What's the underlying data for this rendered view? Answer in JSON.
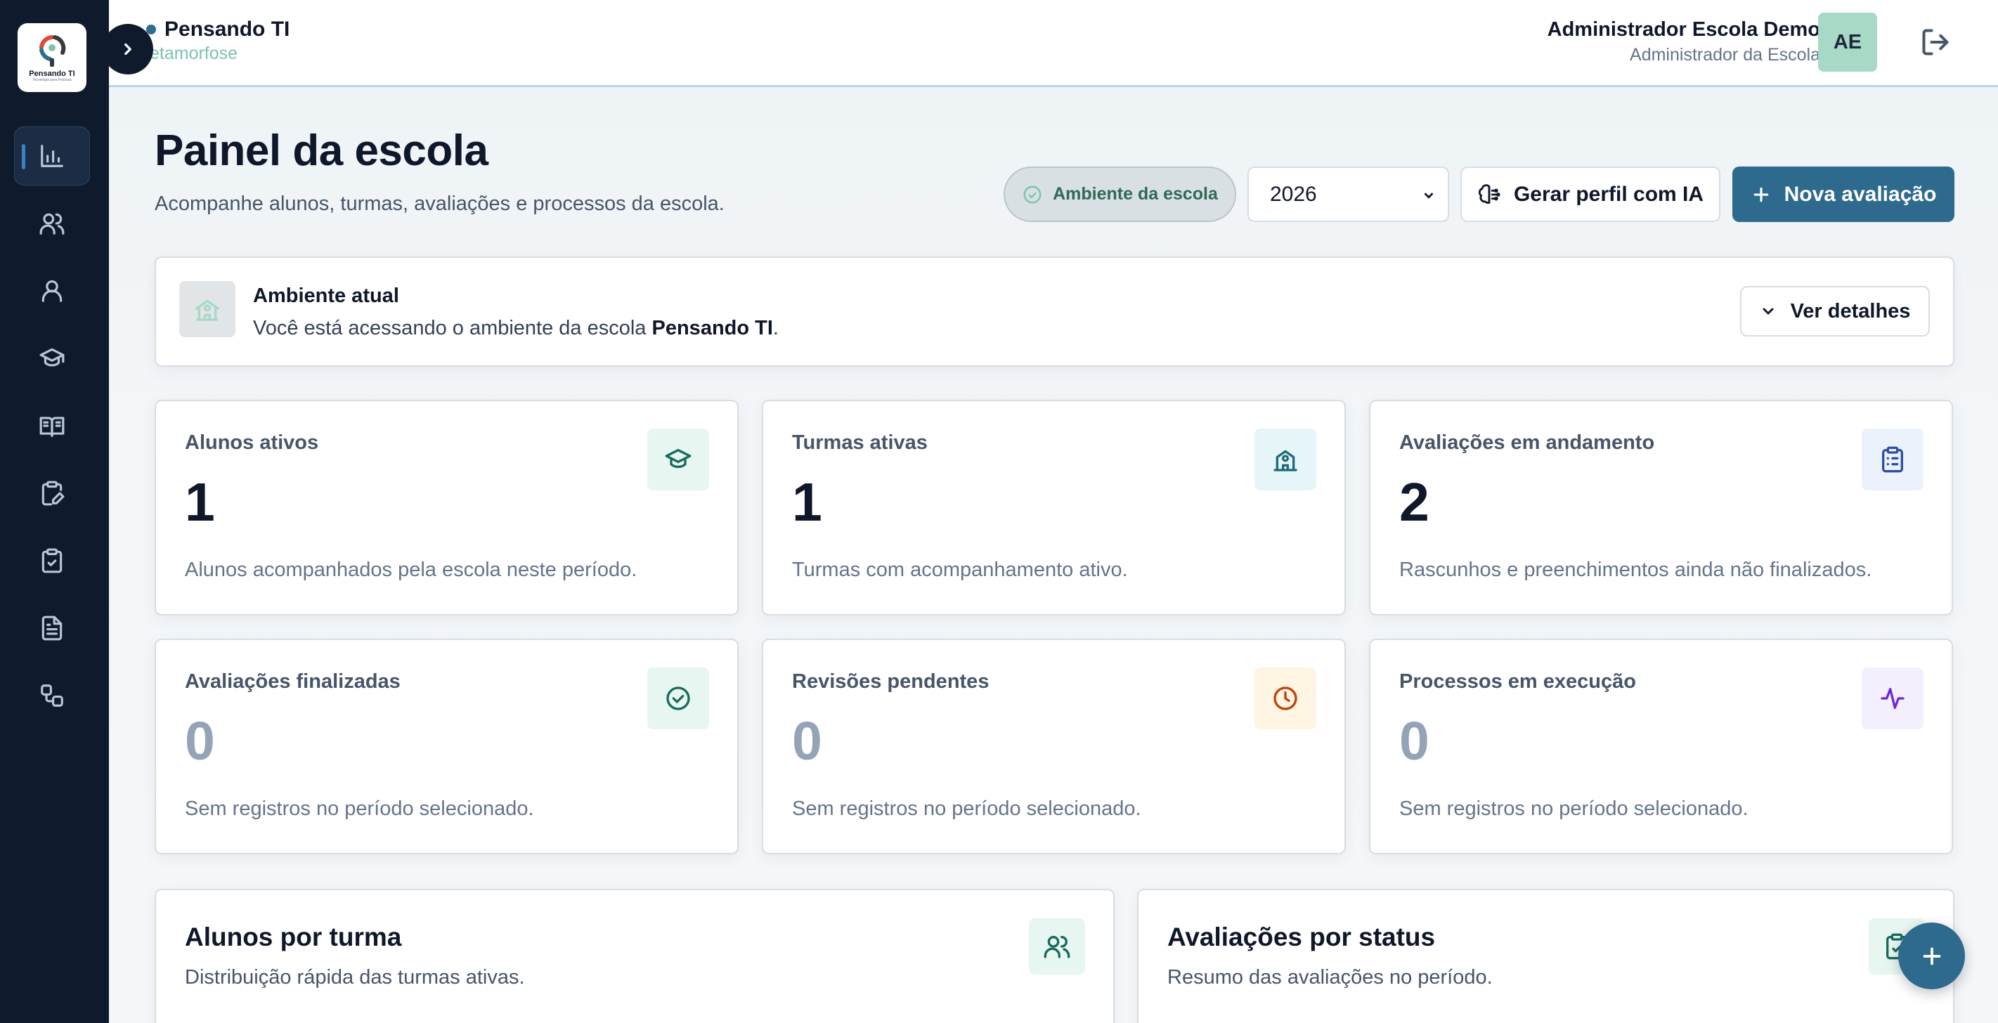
{
  "sidebar": {
    "logo_text": "Pensando TI",
    "logo_subtext": "Tecnologia para Pessoas",
    "items": [
      {
        "name": "dashboard",
        "icon": "bar-chart-icon",
        "active": true
      },
      {
        "name": "users",
        "icon": "users-icon",
        "active": false
      },
      {
        "name": "profile",
        "icon": "user-icon",
        "active": false
      },
      {
        "name": "classes",
        "icon": "graduation-cap-icon",
        "active": false
      },
      {
        "name": "library",
        "icon": "book-open-icon",
        "active": false
      },
      {
        "name": "evaluations",
        "icon": "clipboard-edit-icon",
        "active": false
      },
      {
        "name": "checklists",
        "icon": "clipboard-check-icon",
        "active": false
      },
      {
        "name": "documents",
        "icon": "file-text-icon",
        "active": false
      },
      {
        "name": "workflows",
        "icon": "workflow-icon",
        "active": false
      }
    ]
  },
  "header": {
    "brand_name": "Pensando TI",
    "brand_sub": "etamorfose",
    "user_name": "Administrador Escola Demo",
    "user_role": "Administrador da Escola",
    "avatar_initials": "AE"
  },
  "page": {
    "title": "Painel da escola",
    "subtitle": "Acompanhe alunos, turmas, avaliações e processos da escola."
  },
  "toolbar": {
    "env_pill": "Ambiente da escola",
    "year_selected": "2026",
    "ia_button": "Gerar perfil com IA",
    "new_button": "Nova avaliação"
  },
  "environment": {
    "title": "Ambiente atual",
    "text_prefix": "Você está acessando o ambiente da escola ",
    "school": "Pensando TI",
    "text_suffix": ".",
    "details_button": "Ver detalhes"
  },
  "stats": [
    {
      "label": "Alunos ativos",
      "value": "1",
      "desc": "Alunos acompanhados pela escola neste período.",
      "icon": "graduation-cap-icon",
      "color": "#176b5c",
      "bg": "#e8f6f1"
    },
    {
      "label": "Turmas ativas",
      "value": "1",
      "desc": "Turmas com acompanhamento ativo.",
      "icon": "school-icon",
      "color": "#1d6a7a",
      "bg": "#e6f6f8"
    },
    {
      "label": "Avaliações em andamento",
      "value": "2",
      "desc": "Rascunhos e preenchimentos ainda não finalizados.",
      "icon": "clipboard-list-icon",
      "color": "#2f4fa6",
      "bg": "#ecf2fc"
    },
    {
      "label": "Avaliações finalizadas",
      "value": "0",
      "desc": "Sem registros no período selecionado.",
      "icon": "check-circle-icon",
      "color": "#176b5c",
      "bg": "#e8f6f1"
    },
    {
      "label": "Revisões pendentes",
      "value": "0",
      "desc": "Sem registros no período selecionado.",
      "icon": "clock-icon",
      "color": "#c2410c",
      "bg": "#fdf4e2"
    },
    {
      "label": "Processos em execução",
      "value": "0",
      "desc": "Sem registros no período selecionado.",
      "icon": "activity-icon",
      "color": "#6d28d9",
      "bg": "#f3effc"
    }
  ],
  "panels": [
    {
      "title": "Alunos por turma",
      "subtitle": "Distribuição rápida das turmas ativas.",
      "icon": "users-icon"
    },
    {
      "title": "Avaliações por status",
      "subtitle": "Resumo das avaliações no período.",
      "icon": "clipboard-check-icon"
    }
  ]
}
